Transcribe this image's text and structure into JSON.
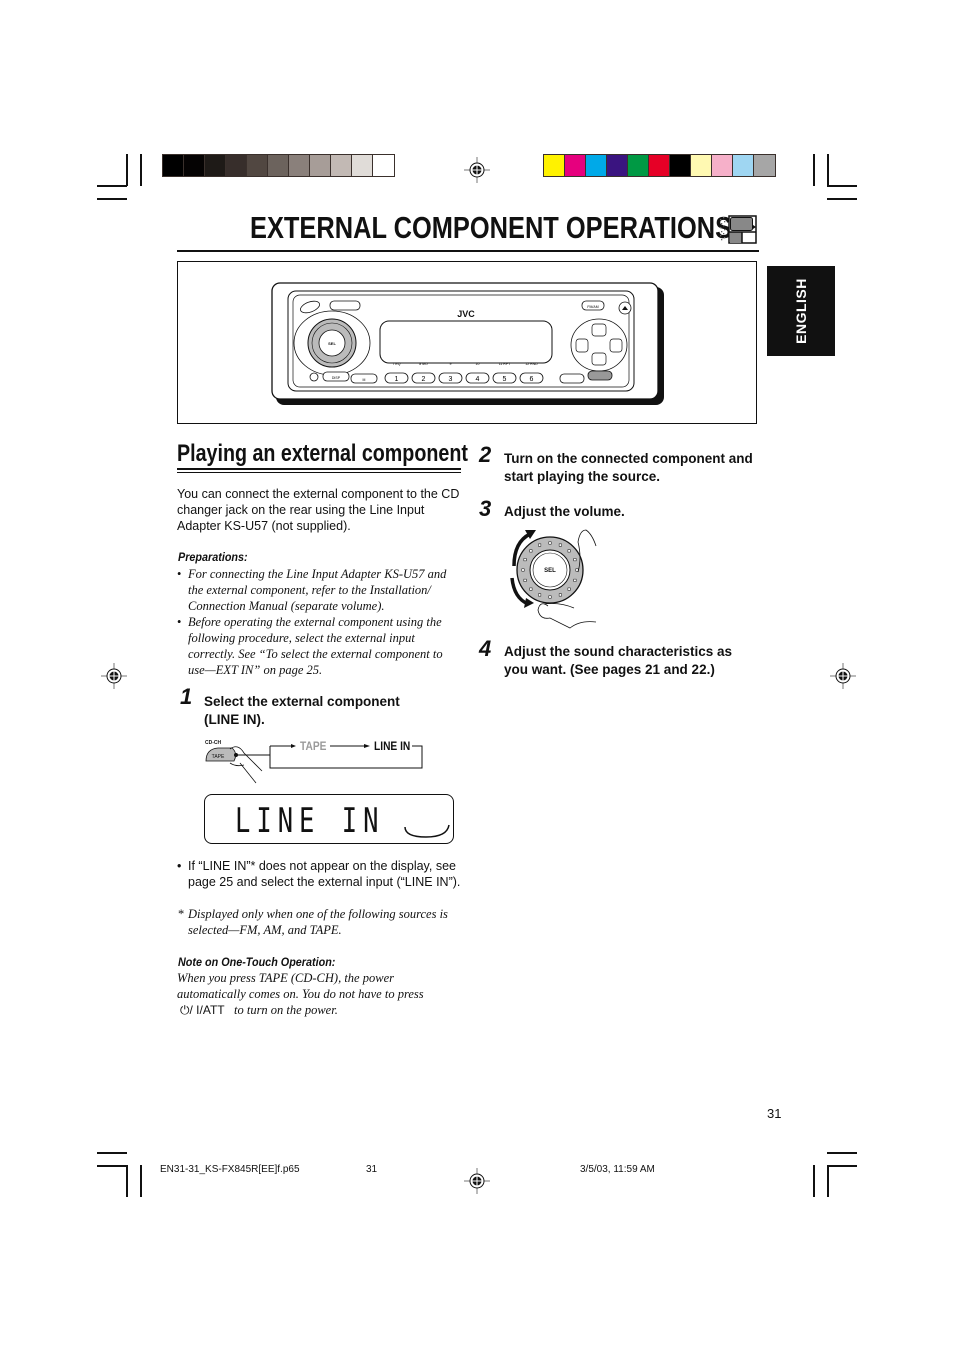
{
  "print_marks": {
    "grayscale_swatches": [
      "#000000",
      "#050303",
      "#1e1a17",
      "#372e2b",
      "#514741",
      "#6c635d",
      "#8a807b",
      "#a79d98",
      "#c2b9b4",
      "#e0dcd8",
      "#ffffff"
    ],
    "color_swatches": [
      "#fff200",
      "#e6007e",
      "#00a9e8",
      "#3a1480",
      "#009944",
      "#e60026",
      "#000000",
      "#fff9b2",
      "#f6b0c9",
      "#9fd6f2",
      "#a6a6a6"
    ]
  },
  "header": {
    "title": "EXTERNAL COMPONENT OPERATIONS",
    "title_icon": "external-component-icon"
  },
  "language_tab": {
    "label": "ENGLISH"
  },
  "illustration": {
    "brand": "JVC",
    "knob_label": "SEL",
    "preset_buttons": [
      "1",
      "2",
      "3",
      "4",
      "5",
      "6"
    ],
    "preset_sublabels": [
      "7  EQ",
      "8  MO",
      "9",
      "10",
      "11  RPT",
      "12  RND"
    ],
    "left_buttons": [
      "DISP",
      "M"
    ],
    "right_buttons": [
      "FM/AM",
      "T",
      "MP3"
    ],
    "small_labels": [
      "BOOT",
      "TP/PTY",
      "CD-CH"
    ]
  },
  "section": {
    "title": "Playing an external component",
    "intro": "You can connect the external component to the CD changer jack on the rear using the Line Input Adapter KS-U57 (not supplied).",
    "preparations_heading": "Preparations:",
    "preparations": [
      "For connecting the Line Input Adapter KS-U57 and the external component, refer to the Installation/ Connection Manual (separate volume).",
      "Before operating the external component using the following procedure, select the external input correctly. See “To select the external component to use—EXT IN” on page 25."
    ]
  },
  "steps": [
    {
      "number": "1",
      "text": "Select the external component (LINE IN)."
    },
    {
      "number": "2",
      "text": "Turn on the connected component and start playing the source."
    },
    {
      "number": "3",
      "text": "Adjust the volume."
    },
    {
      "number": "4",
      "text": "Adjust the sound characteristics as you want. (See pages 21 and 22.)"
    }
  ],
  "step1_diagram": {
    "button_top_label": "CD-CH",
    "button_label": "TAPE",
    "cycle": [
      "TAPE",
      "LINE IN"
    ],
    "tape_color": "#9a9a9a"
  },
  "display": {
    "text": "LINE IN"
  },
  "step3_diagram": {
    "knob_label": "SEL"
  },
  "notes": {
    "bullet": "If “LINE IN”* does not appear on the display, see page 25 and select the external input (“LINE IN”).",
    "footnote_mark": "*",
    "footnote": "Displayed only when one of the following sources is selected—FM, AM, and TAPE.",
    "one_touch_heading": "Note on One-Touch Operation:",
    "one_touch_text_1": "When you press TAPE (CD-CH), the power automatically comes on. You do not have to press",
    "one_touch_button": "⏻/ I/ATT",
    "one_touch_text_2": "to turn on the power."
  },
  "page_number": "31",
  "footer": {
    "file": "EN31-31_KS-FX845R[EE]f.p65",
    "page": "31",
    "timestamp": "3/5/03, 11:59 AM"
  }
}
